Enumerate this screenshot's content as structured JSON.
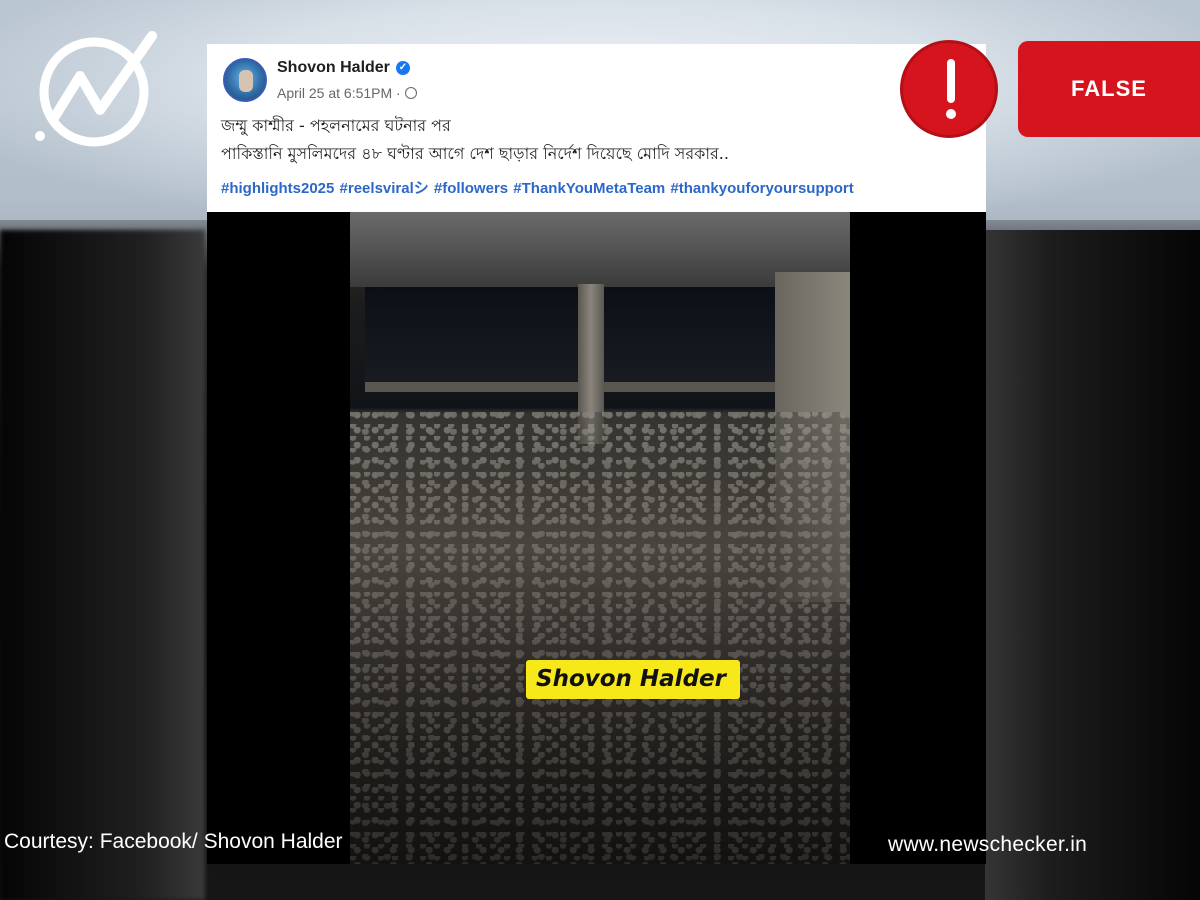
{
  "post": {
    "author": "Shovon Halder",
    "timestamp": "April 25 at 6:51PM ·",
    "line1": "জম্মু কাশ্মীর - পহলনামের ঘটনার পর",
    "line2": "পাকিস্তানি মুসলিমদের ৪৮ ঘণ্টার আগে দেশ ছাড়ার নির্দেশ দিয়েছে মোদি সরকার..",
    "hashtags": "#highlights2025 #reelsviralシ #followers #ThankYouMetaTeam #thankyouforyoursupport",
    "verified_icon": "verified-badge-icon",
    "privacy_icon": "globe-icon"
  },
  "video": {
    "watermark": "Shovon Halder"
  },
  "verdict": {
    "label": "FALSE",
    "icon": "exclamation-icon",
    "color": "#d5141d"
  },
  "footer": {
    "courtesy": "Courtesy: Facebook/ Shovon Halder",
    "site": "www.newschecker.in"
  },
  "brand": {
    "logo_icon": "newschecker-logo-icon"
  }
}
